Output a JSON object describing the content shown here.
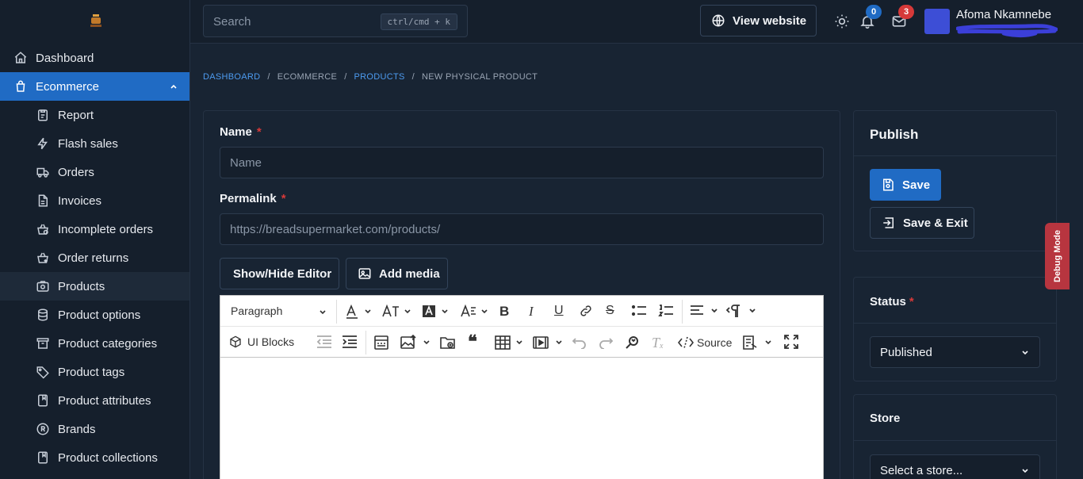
{
  "sidebar": {
    "items": [
      {
        "label": "Dashboard",
        "icon": "home-icon"
      },
      {
        "label": "Ecommerce",
        "icon": "shopping-bag-icon"
      },
      {
        "label": "Report",
        "icon": "report-icon"
      },
      {
        "label": "Flash sales",
        "icon": "bolt-icon"
      },
      {
        "label": "Orders",
        "icon": "truck-icon"
      },
      {
        "label": "Invoices",
        "icon": "file-icon"
      },
      {
        "label": "Incomplete orders",
        "icon": "basket-icon"
      },
      {
        "label": "Order returns",
        "icon": "basket-return-icon"
      },
      {
        "label": "Products",
        "icon": "package-icon"
      },
      {
        "label": "Product options",
        "icon": "database-icon"
      },
      {
        "label": "Product categories",
        "icon": "archive-icon"
      },
      {
        "label": "Product tags",
        "icon": "tag-icon"
      },
      {
        "label": "Product attributes",
        "icon": "album-icon"
      },
      {
        "label": "Brands",
        "icon": "registered-icon"
      },
      {
        "label": "Product collections",
        "icon": "album-icon"
      }
    ]
  },
  "topbar": {
    "search_placeholder": "Search",
    "search_shortcut": "ctrl/cmd + k",
    "view_website": "View website",
    "notifications_count": "0",
    "messages_count": "3",
    "user_name": "Afoma Nkamnebe"
  },
  "breadcrumb": {
    "dashboard": "DASHBOARD",
    "sep": "/",
    "ecommerce": "ECOMMERCE",
    "products": "PRODUCTS",
    "current": "NEW PHYSICAL PRODUCT"
  },
  "form": {
    "name_label": "Name",
    "required_mark": "*",
    "name_placeholder": "Name",
    "permalink_label": "Permalink",
    "permalink_value": "https://breadsupermarket.com/products/",
    "show_hide_editor": "Show/Hide Editor",
    "add_media": "Add media"
  },
  "editor": {
    "paragraph": "Paragraph",
    "ui_blocks": "UI Blocks",
    "source": "Source"
  },
  "publish": {
    "title": "Publish",
    "save": "Save",
    "save_exit": "Save & Exit"
  },
  "status": {
    "title": "Status",
    "value": "Published"
  },
  "store": {
    "title": "Store",
    "placeholder": "Select a store..."
  },
  "debug": "Debug Mode",
  "colors": {
    "accent": "#206bc4",
    "background": "#182433",
    "sidebar": "#151f2c",
    "badge_blue": "#206bc4",
    "badge_red": "#d63939",
    "debug": "#b7353f"
  }
}
